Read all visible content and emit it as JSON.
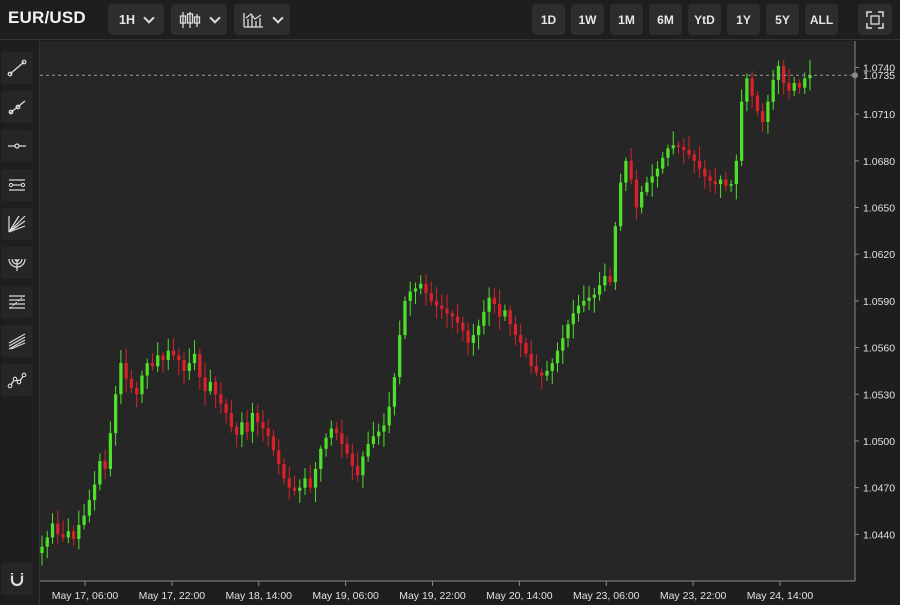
{
  "header": {
    "symbol": "EUR/USD",
    "interval": "1H",
    "chart_type_icon": "candlestick-icon",
    "indicators_icon": "indicators-icon",
    "ranges": [
      "1D",
      "1W",
      "1M",
      "6M",
      "YtD",
      "1Y",
      "5Y",
      "ALL"
    ],
    "fullscreen_icon": "fullscreen-icon"
  },
  "tools": [
    {
      "name": "trend-line-icon"
    },
    {
      "name": "ray-icon"
    },
    {
      "name": "horizontal-line-icon"
    },
    {
      "name": "parallel-channel-icon"
    },
    {
      "name": "fib-fan-icon"
    },
    {
      "name": "fib-arc-icon"
    },
    {
      "name": "fib-retracement-icon"
    },
    {
      "name": "pitchfork-icon"
    },
    {
      "name": "path-icon"
    },
    {
      "name": "magnet-icon"
    }
  ],
  "colors": {
    "up": "#4ee02a",
    "down": "#d9212b",
    "background": "#262626",
    "axis_text": "#e0e0e0"
  },
  "chart_data": {
    "type": "candlestick",
    "y_ticks": [
      "1.0740",
      "1.0710",
      "1.0680",
      "1.0650",
      "1.0620",
      "1.0590",
      "1.0560",
      "1.0530",
      "1.0500",
      "1.0470",
      "1.0440"
    ],
    "x_ticks": [
      "May 17, 06:00",
      "May 17, 22:00",
      "May 18, 14:00",
      "May 19, 06:00",
      "May 19, 22:00",
      "May 20, 14:00",
      "May 23, 06:00",
      "May 23, 22:00",
      "May 24, 14:00"
    ],
    "last_price": "1.0735",
    "ylim": [
      1.041,
      1.0757
    ],
    "closes": [
      1.0432,
      1.0438,
      1.0447,
      1.044,
      1.0438,
      1.0442,
      1.0437,
      1.0446,
      1.0452,
      1.0462,
      1.0472,
      1.0487,
      1.0482,
      1.0505,
      1.053,
      1.055,
      1.054,
      1.0534,
      1.053,
      1.0542,
      1.055,
      1.0548,
      1.0555,
      1.0552,
      1.0558,
      1.0555,
      1.0552,
      1.0545,
      1.055,
      1.0556,
      1.0541,
      1.0532,
      1.0538,
      1.053,
      1.0524,
      1.0518,
      1.0509,
      1.0504,
      1.0512,
      1.0506,
      1.0518,
      1.0512,
      1.0508,
      1.0503,
      1.0494,
      1.0485,
      1.0476,
      1.047,
      1.0468,
      1.047,
      1.0476,
      1.047,
      1.0482,
      1.0495,
      1.0502,
      1.0508,
      1.0505,
      1.0498,
      1.0492,
      1.0484,
      1.0478,
      1.049,
      1.0498,
      1.0503,
      1.0506,
      1.051,
      1.0522,
      1.0541,
      1.0568,
      1.059,
      1.0596,
      1.0598,
      1.0601,
      1.0595,
      1.059,
      1.0587,
      1.0585,
      1.0582,
      1.058,
      1.0576,
      1.0571,
      1.0563,
      1.0568,
      1.0574,
      1.0583,
      1.0592,
      1.0588,
      1.058,
      1.0584,
      1.0575,
      1.0568,
      1.0563,
      1.0556,
      1.0548,
      1.0544,
      1.0542,
      1.0545,
      1.055,
      1.0558,
      1.0566,
      1.0575,
      1.0582,
      1.0587,
      1.059,
      1.0592,
      1.0594,
      1.06,
      1.0606,
      1.0602,
      1.0638,
      1.0666,
      1.068,
      1.0668,
      1.065,
      1.066,
      1.0666,
      1.067,
      1.0675,
      1.0682,
      1.0688,
      1.069,
      1.0689,
      1.0687,
      1.0684,
      1.068,
      1.0675,
      1.067,
      1.0667,
      1.0665,
      1.0668,
      1.0664,
      1.0665,
      1.068,
      1.0718,
      1.0733,
      1.0722,
      1.0712,
      1.0705,
      1.0718,
      1.0732,
      1.0741,
      1.073,
      1.0725,
      1.073,
      1.0727,
      1.0733,
      1.0735
    ]
  }
}
